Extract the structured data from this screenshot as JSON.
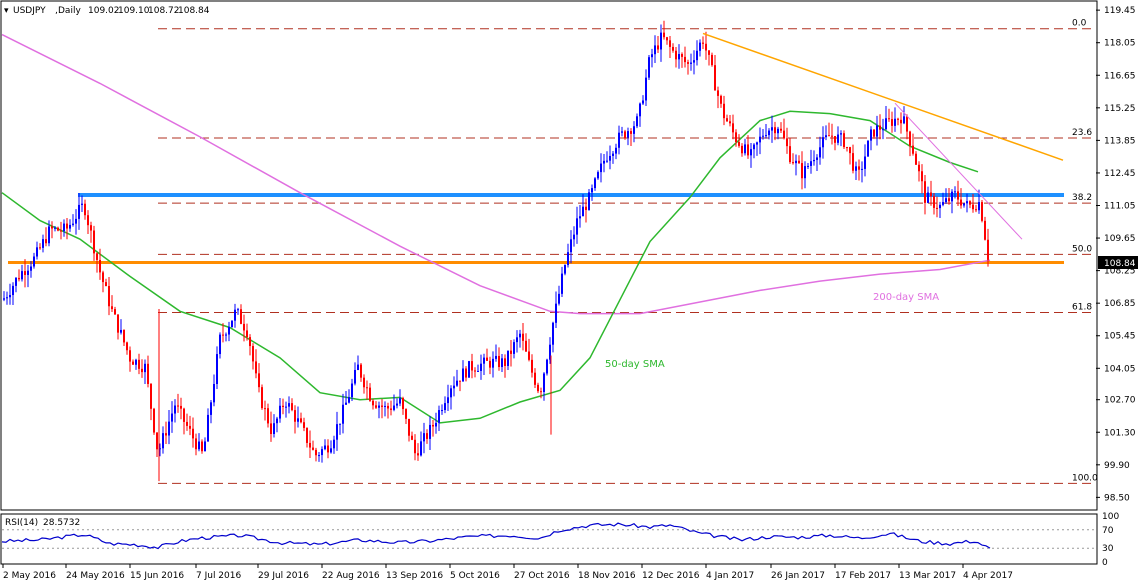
{
  "chart_data": {
    "type": "candlestick",
    "symbol": "USDJPY",
    "timeframe": "Daily",
    "ohlc_header": [
      "109.02",
      "109.10",
      "108.72",
      "108.84"
    ],
    "current_price": "108.84",
    "ylim": [
      98.0,
      119.8
    ],
    "y_ticks": [
      "119.45",
      "118.05",
      "116.65",
      "115.25",
      "113.85",
      "112.45",
      "111.05",
      "109.65",
      "108.25",
      "106.85",
      "105.45",
      "104.05",
      "102.70",
      "101.30",
      "99.90",
      "98.50"
    ],
    "x_ticks": [
      "2 May 2016",
      "24 May 2016",
      "15 Jun 2016",
      "7 Jul 2016",
      "29 Jul 2016",
      "22 Aug 2016",
      "13 Sep 2016",
      "5 Oct 2016",
      "27 Oct 2016",
      "18 Nov 2016",
      "12 Dec 2016",
      "4 Jan 2017",
      "26 Jan 2017",
      "17 Feb 2017",
      "13 Mar 2017",
      "4 Apr 2017"
    ],
    "fibonacci": [
      {
        "label": "0.0",
        "price": 118.65
      },
      {
        "label": "23.6",
        "price": 113.95
      },
      {
        "label": "38.2",
        "price": 111.15
      },
      {
        "label": "50.0",
        "price": 108.95
      },
      {
        "label": "61.8",
        "price": 106.45
      },
      {
        "label": "100.0",
        "price": 99.1
      }
    ],
    "horizontal_lines": [
      {
        "name": "resistance",
        "price": 111.5,
        "color": "#1e90ff"
      },
      {
        "name": "support",
        "price": 108.6,
        "color": "#ff8c00"
      }
    ],
    "sma_labels": {
      "sma50": "50-day SMA",
      "sma200": "200-day SMA"
    },
    "sma_colors": {
      "sma50": "#2eb82e",
      "sma200": "#e070e0"
    },
    "trendline_color": "#ffa500",
    "trendline2_color": "#e070e0",
    "rsi": {
      "label": "RSI(14)",
      "value": "28.5732",
      "ticks": [
        "100",
        "70",
        "30",
        "0"
      ],
      "color": "#0000cc"
    },
    "candle_colors": {
      "up": "#0000ff",
      "down": "#ff0000"
    }
  }
}
